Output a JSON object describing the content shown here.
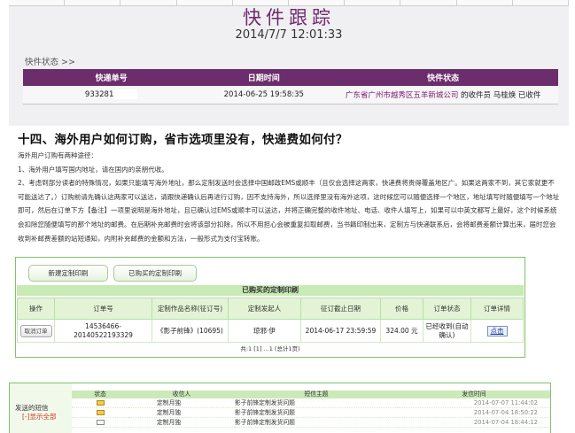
{
  "tracking": {
    "title": "快件跟踪",
    "datetime": "2014/7/7 12:01:33",
    "status_label": "快件状态 >>",
    "columns": [
      "快递单号",
      "日期时间",
      "快件状态"
    ],
    "row": {
      "tracking_no": "933281",
      "datetime": "2014-06-25 19:58:35",
      "status_location": "广东省广州市越秀区五羊新城公司",
      "status_courier": "的收件员 马桂焕 已收件"
    }
  },
  "faq": {
    "heading": "十四、海外用户如何订购，省市选项里没有，快递费如何付？",
    "intro": "海外用户订购有两种途径：",
    "p1": "1、海外用户填写国内地址，请在国内的亲朋代收。",
    "p2": "2、考虑到部分读者的特殊情况，如果只能填写海外地址，那么定制发送时会选择中国邮政EMS或顺丰（且仅会选择这两家，快递费将贵得覆盖地区广。如果这两家不到，其它家就更不可能送达了。）订购前请先确认这两家可以送达，请跟快递确认后再进行订购，因不支持海外，所以选择里没有海外这项，这时候您可以随便选择一个地区，地址填写时随便填写一个地址即可，然后在订单下方【备注】一项里说明是海外地址，且已确认过EMS或顺丰可以送达，并将正确完整的收件地址、电话、收件人填写上，如果可以中英文都写上最好，这个时候系统会扣除您随便填写的那个地址的邮费。在后期补充邮费时会将该部分扣除，所以不用担心会被重复扣取邮费，当书籍印制出来，定制方与快递联系后，会将邮费差额计算出来，届时您会收到补邮费差额的站短通知，内附补充邮费的金额和方法，一般形式为支付宝转账。"
  },
  "custom": {
    "btn_new": "新建定制印刷",
    "btn_bought": "已购买的定制印刷",
    "title": "已购买的定制印刷",
    "columns": [
      "操作",
      "订单号",
      "定制作品名称(征订号)",
      "定制发起人",
      "征订截止日期",
      "价格",
      "订单状态",
      "订单详情"
    ],
    "row": {
      "action": "取消订单",
      "order_no": "14536466-20140522193329",
      "work": "《影子前锋》(10695)",
      "initiator": "琼邪·伊",
      "deadline": "2014-06-17 23:59:59",
      "price": "324.00 元",
      "status": "已经收到(自动确认)",
      "detail": "点击"
    },
    "pager": "共:1 [1] ...1 (总计1页)"
  },
  "messages": {
    "left_label": "发送的短信",
    "left_link": "[-]显示全部",
    "columns": [
      "状态",
      "收信人",
      "短信主题",
      "发信时间"
    ],
    "rows": [
      {
        "icon": "envelope-closed",
        "recipient": "定制月独",
        "subject": "影子前锋定制发货问题",
        "time": "2014-07-07 11:44:02"
      },
      {
        "icon": "envelope-closed",
        "recipient": "定制月独",
        "subject": "影子前锋定制发货问题",
        "time": "2014-07-04 18:50:22"
      },
      {
        "icon": "envelope-open",
        "recipient": "定制月独",
        "subject": "影子前锋定制发货问题",
        "time": "2014-07-04 18:44:12"
      }
    ]
  },
  "colors": {
    "tracking_header": "#6c2d6c",
    "custom_border": "#7ec36a",
    "custom_header": "#c8eab4"
  }
}
